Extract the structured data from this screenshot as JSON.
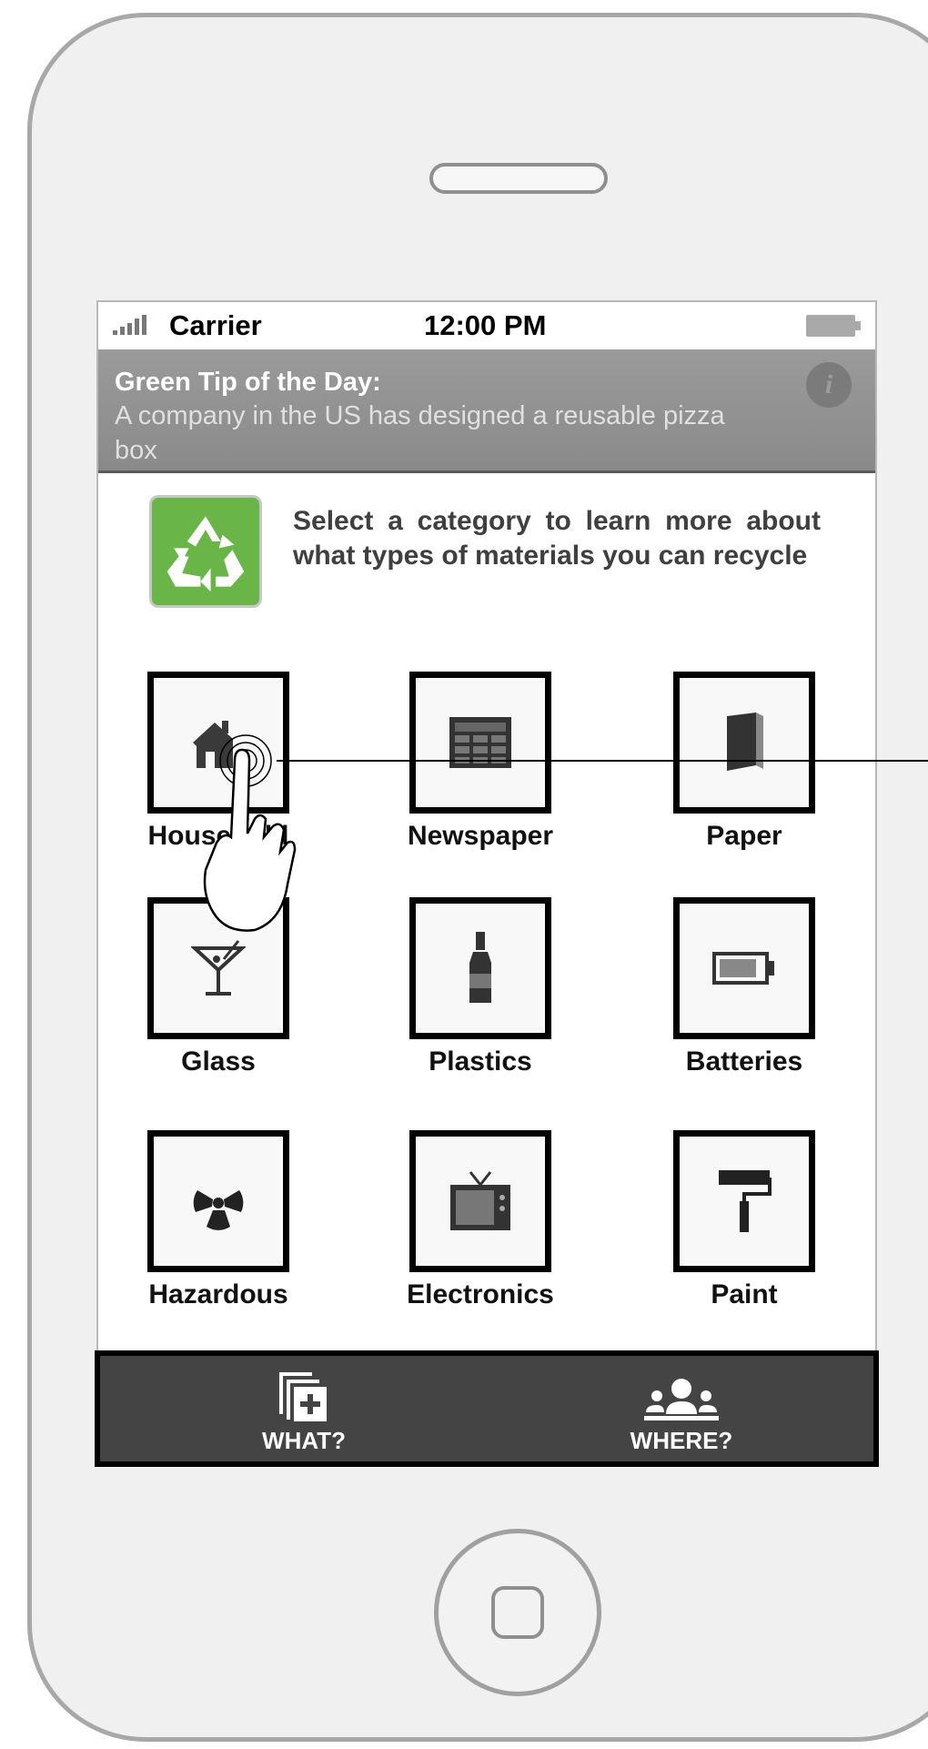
{
  "status_bar": {
    "carrier": "Carrier",
    "time": "12:00 PM"
  },
  "tip": {
    "title": "Green Tip of the Day:",
    "text": "A company in the US has designed a reusable pizza box",
    "info_icon": "info-icon"
  },
  "intro": {
    "logo_icon": "recycle-icon",
    "text": "Select a category to learn more about what types of materials you can recycle"
  },
  "categories": [
    {
      "label": "Household",
      "icon": "house-icon"
    },
    {
      "label": "Newspaper",
      "icon": "newspaper-icon"
    },
    {
      "label": "Paper",
      "icon": "book-icon"
    },
    {
      "label": "Glass",
      "icon": "martini-glass-icon"
    },
    {
      "label": "Plastics",
      "icon": "bottle-icon"
    },
    {
      "label": "Batteries",
      "icon": "battery-icon"
    },
    {
      "label": "Hazardous",
      "icon": "radiation-icon"
    },
    {
      "label": "Electronics",
      "icon": "tv-icon"
    },
    {
      "label": "Paint",
      "icon": "paint-roller-icon"
    }
  ],
  "tab_bar": {
    "what_label": "WHAT?",
    "where_label": "WHERE?"
  },
  "colors": {
    "banner": "#8f8f8f",
    "tab_bar": "#444444",
    "recycle_green": "#6ab547",
    "frame": "#f0f0f0"
  }
}
